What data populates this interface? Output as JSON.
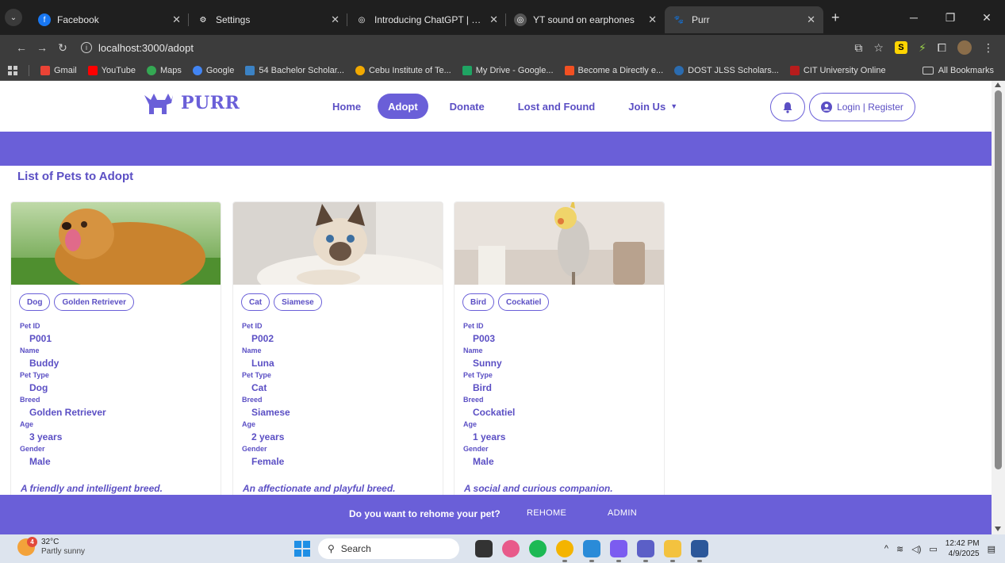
{
  "browser": {
    "tabs": [
      {
        "title": "Facebook",
        "icon": "facebook-icon",
        "color": "#1877f2",
        "active": false
      },
      {
        "title": "Settings",
        "icon": "gear-icon",
        "color": "#444444",
        "active": false
      },
      {
        "title": "Introducing ChatGPT | OpenAI",
        "icon": "openai-icon",
        "color": "#444444",
        "active": false
      },
      {
        "title": "YT sound on earphones",
        "icon": "chatgpt-icon",
        "color": "#444444",
        "active": false
      },
      {
        "title": "Purr",
        "icon": "cat-icon",
        "color": "#6a5fd8",
        "active": true
      }
    ],
    "url": "localhost:3000/adopt",
    "bookmarks": [
      {
        "label": "Gmail",
        "color": "#ea4335"
      },
      {
        "label": "YouTube",
        "color": "#ff0000"
      },
      {
        "label": "Maps",
        "color": "#34a853"
      },
      {
        "label": "Google",
        "color": "#4285f4"
      },
      {
        "label": "54 Bachelor Scholar...",
        "color": "#3b82c4"
      },
      {
        "label": "Cebu Institute of Te...",
        "color": "#f2a900"
      },
      {
        "label": "My Drive - Google...",
        "color": "#1fa463"
      },
      {
        "label": "Become a Directly e...",
        "color": "#f25022"
      },
      {
        "label": "DOST JLSS Scholars...",
        "color": "#2b6cb0"
      },
      {
        "label": "CIT University Online",
        "color": "#b71c1c"
      }
    ],
    "all_bookmarks": "All Bookmarks"
  },
  "site": {
    "brand": "PURR",
    "nav": [
      {
        "label": "Home",
        "active": false
      },
      {
        "label": "Adopt",
        "active": true
      },
      {
        "label": "Donate",
        "active": false
      },
      {
        "label": "Lost and Found",
        "active": false
      },
      {
        "label": "Join Us",
        "active": false
      }
    ],
    "login_label": "Login | Register",
    "section_title": "List of Pets to Adopt",
    "field_labels": {
      "id": "Pet ID",
      "name": "Name",
      "type": "Pet Type",
      "breed": "Breed",
      "age": "Age",
      "gender": "Gender"
    },
    "pets": [
      {
        "type": "Dog",
        "breed": "Golden Retriever",
        "id": "P001",
        "name": "Buddy",
        "age": "3 years",
        "gender": "Male",
        "desc": "A friendly and intelligent breed."
      },
      {
        "type": "Cat",
        "breed": "Siamese",
        "id": "P002",
        "name": "Luna",
        "age": "2 years",
        "gender": "Female",
        "desc": "An affectionate and playful breed."
      },
      {
        "type": "Bird",
        "breed": "Cockatiel",
        "id": "P003",
        "name": "Sunny",
        "age": "1 years",
        "gender": "Male",
        "desc": "A social and curious companion."
      }
    ],
    "footer": {
      "question": "Do you want to rehome your pet?",
      "rehome": "REHOME",
      "admin": "ADMIN"
    },
    "accent": "#6a5fd8"
  },
  "taskbar": {
    "weather_temp": "32°C",
    "weather_desc": "Partly sunny",
    "weather_badge": "4",
    "search": "Search",
    "time": "12:42 PM",
    "date": "4/9/2025"
  }
}
